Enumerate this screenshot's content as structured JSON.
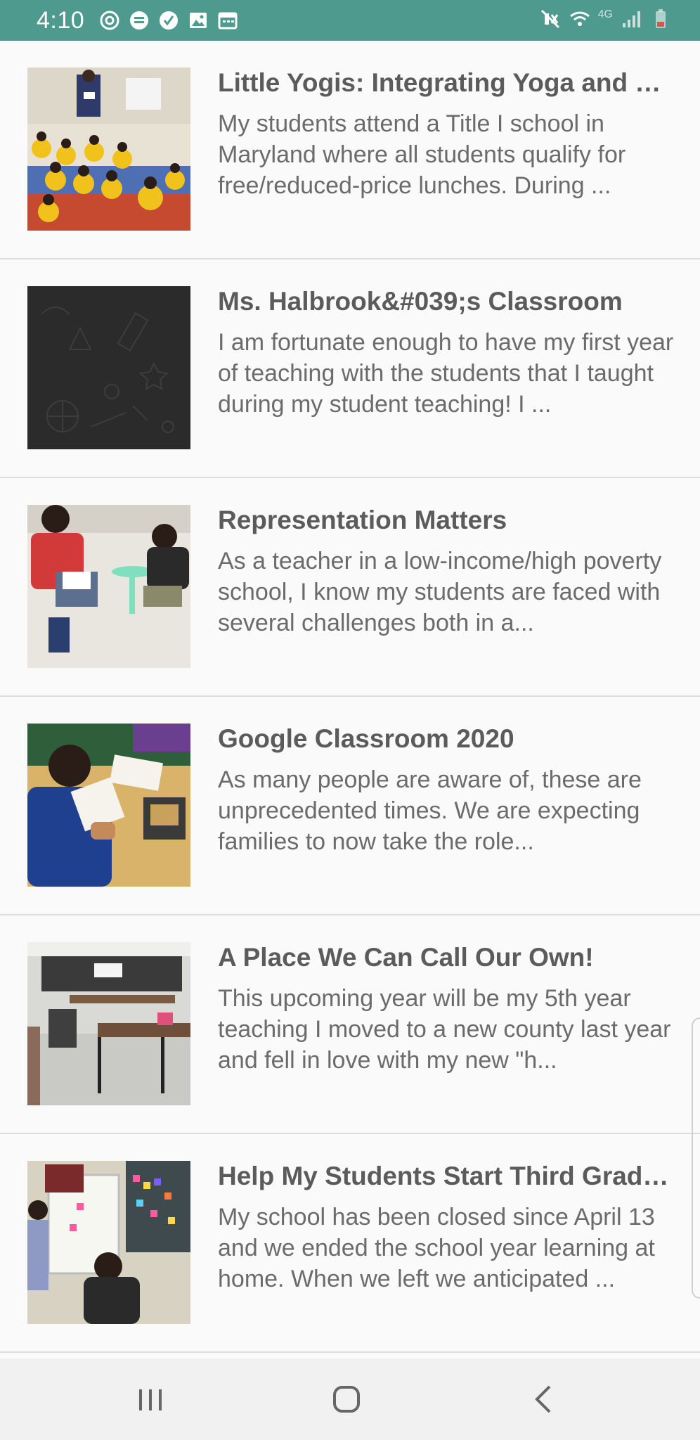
{
  "status_bar": {
    "time": "4:10",
    "left_icons": [
      "sync-icon",
      "message-icon",
      "check-icon",
      "image-icon",
      "calendar-icon"
    ],
    "network_label": "4G",
    "right_icons": [
      "mute-icon",
      "wifi-icon",
      "signal-icon",
      "battery-icon"
    ]
  },
  "projects": [
    {
      "title": "Little Yogis: Integrating Yoga and Mi...",
      "description": "My students attend a Title I school in Maryland where all students qualify for free/reduced-price lunches. During ..."
    },
    {
      "title": "Ms. Halbrook&#039;s Classroom",
      "description": "I am fortunate enough to have my first year of teaching with the students that I taught during my student teaching! I ..."
    },
    {
      "title": "Representation Matters",
      "description": "As a teacher in a low-income/high poverty school, I know my students are faced with several challenges both in a..."
    },
    {
      "title": "Google Classroom 2020",
      "description": "As many people are aware of, these are unprecedented times. We are expecting families to now take the role..."
    },
    {
      "title": "A Place We Can Call Our Own!",
      "description": "This upcoming year will be my 5th year teaching I moved to a new county last year and fell in love with my new \"h..."
    },
    {
      "title": "Help My Students Start Third Grade ...",
      "description": "My school has been closed since April 13 and we ended the school year learning at home. When we left we anticipated ..."
    }
  ],
  "nav_bar": {
    "buttons": [
      "recent-apps-icon",
      "home-icon",
      "back-icon"
    ]
  },
  "colors": {
    "status_bar": "#4f9a8f",
    "background": "#fafafa",
    "title_text": "#5b5b5b",
    "body_text": "#6b6b6b",
    "divider": "#dcdcdc",
    "nav_bar": "#f1f1f1"
  }
}
